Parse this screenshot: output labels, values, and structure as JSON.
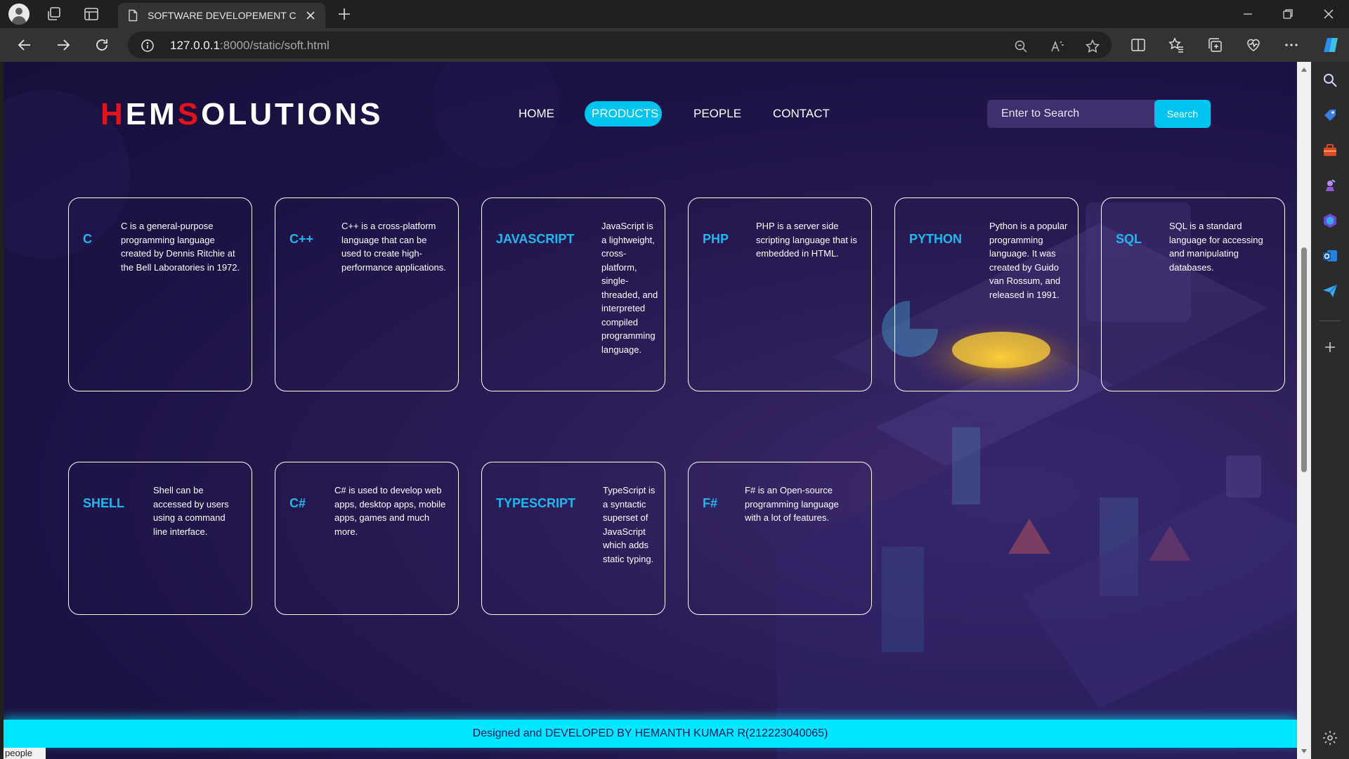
{
  "browser": {
    "tab_title": "SOFTWARE DEVELOPEMENT CO",
    "url_host": "127.0.0.1",
    "url_path": ":8000/static/soft.html"
  },
  "site": {
    "logo": {
      "h": "H",
      "em": "EM",
      "s": "S",
      "olutions": "OLUTIONS"
    },
    "nav": [
      "HOME",
      "PRODUCTS",
      "PEOPLE",
      "CONTACT"
    ],
    "nav_active": "PRODUCTS",
    "search_placeholder": "Enter to Search",
    "search_button": "Search",
    "cards": [
      {
        "name": "C",
        "desc": "C is a general-purpose programming language created by Dennis Ritchie at the Bell Laboratories in 1972."
      },
      {
        "name": "C++",
        "desc": "C++ is a cross-platform language that can be used to create high-performance applications."
      },
      {
        "name": "JAVASCRIPT",
        "desc": "JavaScript is a lightweight, cross-platform, single-threaded, and interpreted compiled programming language."
      },
      {
        "name": "PHP",
        "desc": "PHP is a server side scripting language that is embedded in HTML."
      },
      {
        "name": "PYTHON",
        "desc": "Python is a popular programming language. It was created by Guido van Rossum, and released in 1991."
      },
      {
        "name": "SQL",
        "desc": "SQL is a standard language for accessing and manipulating databases."
      },
      {
        "name": "SHELL",
        "desc": "Shell can be accessed by users using a command line interface."
      },
      {
        "name": "C#",
        "desc": "C# is used to develop web apps, desktop apps, mobile apps, games and much more."
      },
      {
        "name": "TYPESCRIPT",
        "desc": "TypeScript is a syntactic superset of JavaScript which adds static typing."
      },
      {
        "name": "F#",
        "desc": "F# is an Open-source programming language with a lot of features."
      }
    ],
    "footer": "Designed and DEVELOPED BY HEMANTH KUMAR R(212223040065)",
    "status_bar": "people"
  },
  "colors": {
    "accent": "#00c4f0",
    "logo_red": "#e3131c",
    "card_title": "#1fb8f0",
    "footer_bg": "#00e7ff",
    "page_bg": "#1c1244"
  },
  "icons": [
    "profile-icon",
    "workspaces-icon",
    "tab-actions-icon",
    "page-icon",
    "close-icon",
    "plus-icon",
    "minimize-icon",
    "restore-icon",
    "back-icon",
    "forward-icon",
    "refresh-icon",
    "info-icon",
    "zoom-icon",
    "read-aloud-icon",
    "star-icon",
    "split-screen-icon",
    "favorites-icon",
    "collections-icon",
    "browser-essentials-icon",
    "more-icon",
    "copilot-icon",
    "search-icon",
    "shopping-icon",
    "tools-icon",
    "games-icon",
    "microsoft365-icon",
    "outlook-icon",
    "send-icon",
    "settings-icon"
  ]
}
